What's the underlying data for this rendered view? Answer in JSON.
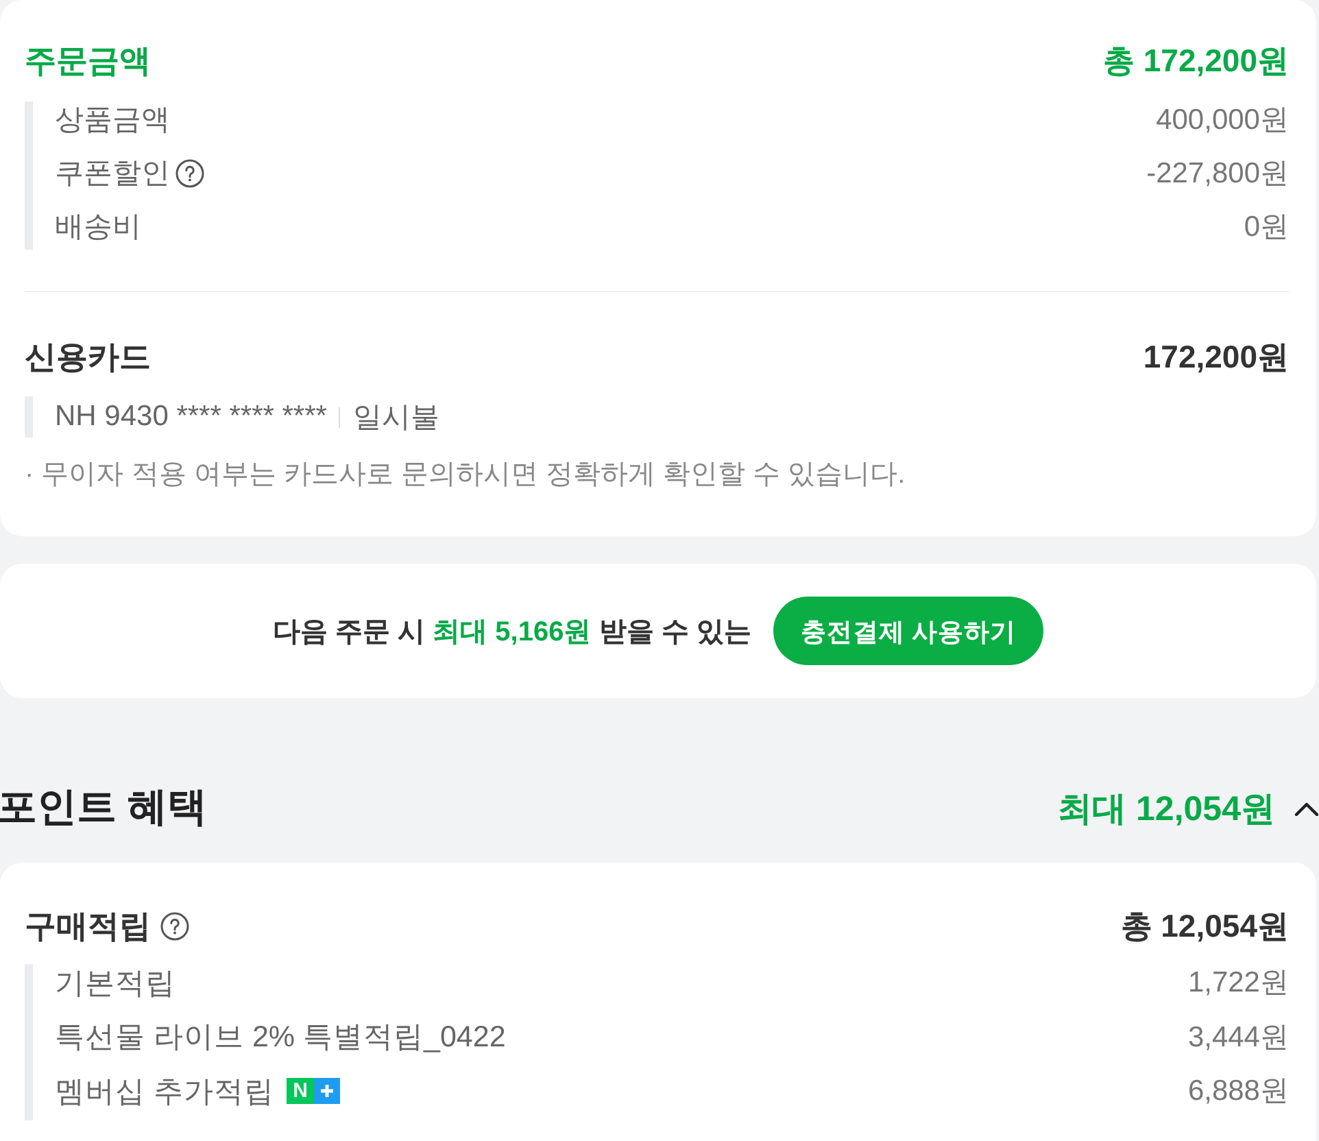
{
  "order_amount": {
    "title": "주문금액",
    "total": "총 172,200원",
    "items": [
      {
        "label": "상품금액",
        "value": "400,000원",
        "help": false
      },
      {
        "label": "쿠폰할인",
        "value": "-227,800원",
        "help": true
      },
      {
        "label": "배송비",
        "value": "0원",
        "help": false
      }
    ]
  },
  "payment": {
    "method": "신용카드",
    "amount": "172,200원",
    "card": "NH 9430 **** **** ****",
    "installment": "일시불",
    "note": "· 무이자 적용 여부는 카드사로 문의하시면 정확하게 확인할 수 있습니다."
  },
  "promo": {
    "before": "다음 주문 시",
    "highlight": "최대 5,166원",
    "after": "받을 수 있는",
    "button": "충전결제 사용하기"
  },
  "points": {
    "title": "포인트 혜택",
    "total": "최대 12,054원",
    "expanded": true,
    "purchase": {
      "title": "구매적립",
      "help": true,
      "total": "총 12,054원",
      "items": [
        {
          "label": "기본적립",
          "value": "1,722원"
        },
        {
          "label": "특선물 라이브 2% 특별적립_0422",
          "value": "3,444원"
        },
        {
          "label": "멤버십 추가적립",
          "value": "6,888원",
          "badge": "N"
        }
      ]
    }
  }
}
